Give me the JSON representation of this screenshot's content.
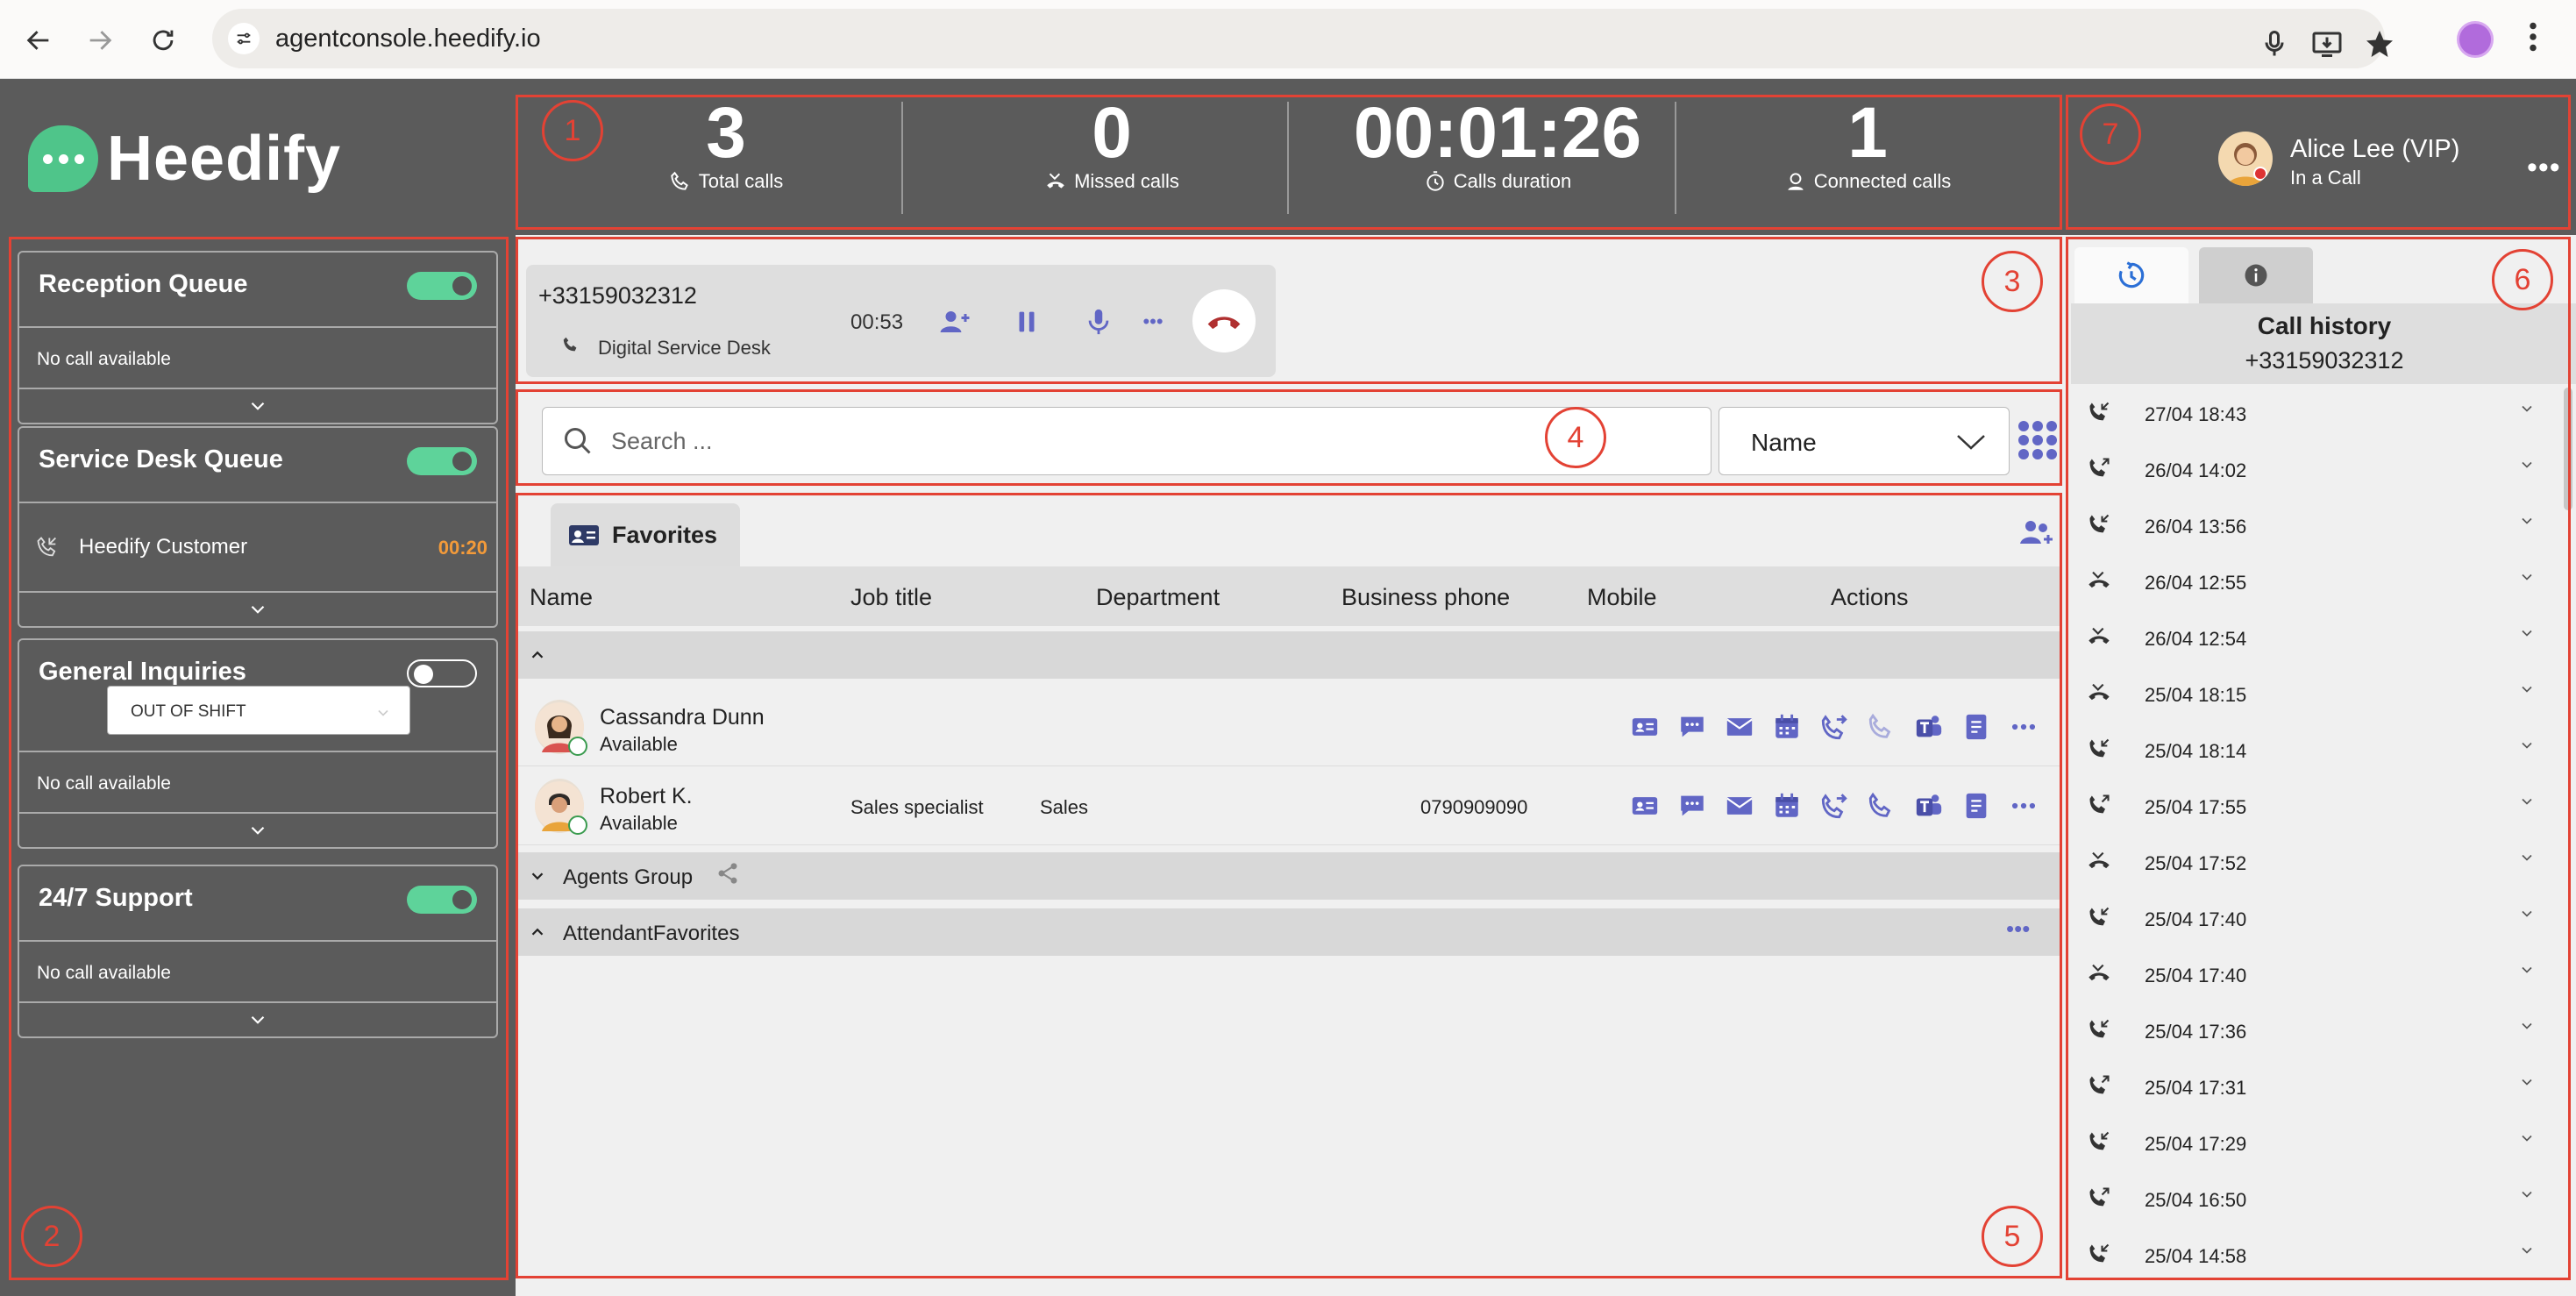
{
  "browser": {
    "url": "agentconsole.heedify.io"
  },
  "logo": {
    "text": "Heedify"
  },
  "zones": [
    "1",
    "2",
    "3",
    "4",
    "5",
    "6",
    "7"
  ],
  "stats": [
    {
      "value": "3",
      "label": "Total calls",
      "icon": "phone-icon"
    },
    {
      "value": "0",
      "label": "Missed calls",
      "icon": "missed-call-icon"
    },
    {
      "value": "00:01:26",
      "label": "Calls duration",
      "icon": "timer-icon"
    },
    {
      "value": "1",
      "label": "Connected calls",
      "icon": "agent-icon"
    }
  ],
  "user": {
    "name": "Alice Lee (VIP)",
    "status": "In a Call",
    "more": "•••"
  },
  "queues": [
    {
      "title": "Reception Queue",
      "enabled": true,
      "empty_text": "No call available"
    },
    {
      "title": "Service Desk Queue",
      "enabled": true,
      "caller": "Heedify Customer",
      "wait": "00:20"
    },
    {
      "title": "General Inquiries",
      "enabled": false,
      "shift": "OUT OF SHIFT",
      "empty_text": "No call available"
    },
    {
      "title": "24/7 Support",
      "enabled": true,
      "empty_text": "No call available"
    }
  ],
  "active_call": {
    "number": "+33159032312",
    "destination": "Digital Service Desk",
    "timer": "00:53",
    "more": "•••"
  },
  "search": {
    "placeholder": "Search ...",
    "filter_value": "Name"
  },
  "favorites": {
    "tab_label": "Favorites",
    "columns": [
      "Name",
      "Job title",
      "Department",
      "Business phone",
      "Mobile",
      "Actions"
    ],
    "contacts": [
      {
        "name": "Cassandra Dunn",
        "status": "Available",
        "job": "",
        "dept": "",
        "phone": ""
      },
      {
        "name": "Robert K.",
        "status": "Available",
        "job": "Sales specialist",
        "dept": "Sales",
        "phone": "0790909090"
      }
    ],
    "groups": [
      "Agents Group",
      "AttendantFavorites"
    ],
    "group_more": "•••"
  },
  "history": {
    "title": "Call history",
    "number": "+33159032312",
    "entries": [
      {
        "time": "27/04 18:43",
        "type": "incoming"
      },
      {
        "time": "26/04 14:02",
        "type": "outgoing"
      },
      {
        "time": "26/04 13:56",
        "type": "incoming"
      },
      {
        "time": "26/04 12:55",
        "type": "missed"
      },
      {
        "time": "26/04 12:54",
        "type": "missed"
      },
      {
        "time": "25/04 18:15",
        "type": "missed"
      },
      {
        "time": "25/04 18:14",
        "type": "incoming"
      },
      {
        "time": "25/04 17:55",
        "type": "outgoing"
      },
      {
        "time": "25/04 17:52",
        "type": "missed"
      },
      {
        "time": "25/04 17:40",
        "type": "incoming"
      },
      {
        "time": "25/04 17:40",
        "type": "missed"
      },
      {
        "time": "25/04 17:36",
        "type": "incoming"
      },
      {
        "time": "25/04 17:31",
        "type": "outgoing"
      },
      {
        "time": "25/04 17:29",
        "type": "incoming"
      },
      {
        "time": "25/04 16:50",
        "type": "outgoing"
      },
      {
        "time": "25/04 14:58",
        "type": "incoming"
      }
    ]
  },
  "colors": {
    "accent": "#6166c5",
    "zone": "#e34234",
    "toggle_on": "#5ed39a",
    "wait": "#f29a3a",
    "hangup": "#b03030"
  }
}
